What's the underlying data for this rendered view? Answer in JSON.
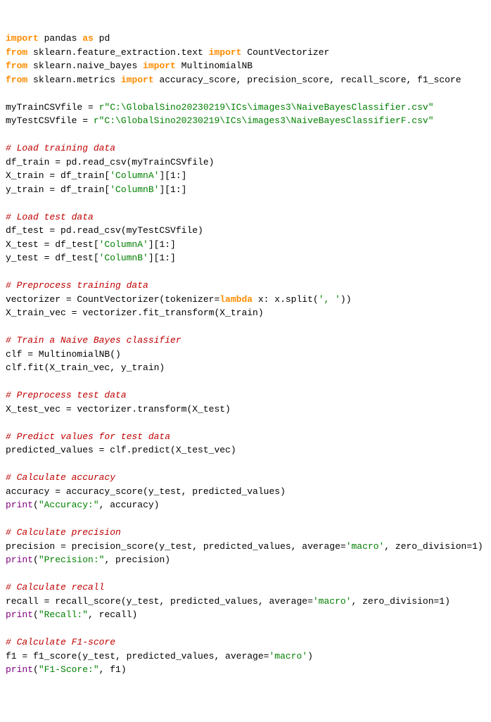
{
  "code": {
    "l1_kw1": "import",
    "l1_nm1": " pandas ",
    "l1_kw2": "as",
    "l1_nm2": " pd",
    "l2_kw1": "from",
    "l2_nm1": " sklearn.feature_extraction.text ",
    "l2_kw2": "import",
    "l2_nm2": " CountVectorizer",
    "l3_kw1": "from",
    "l3_nm1": " sklearn.naive_bayes ",
    "l3_kw2": "import",
    "l3_nm2": " MultinomialNB",
    "l4_kw1": "from",
    "l4_nm1": " sklearn.metrics ",
    "l4_kw2": "import",
    "l4_nm2": " accuracy_score, precision_score, recall_score, f1_score",
    "l6_nm1": "myTrainCSVfile = ",
    "l6_str1": "r\"C:\\GlobalSino20230219\\ICs\\images3\\NaiveBayesClassifier.csv\"",
    "l7_nm1": "myTestCSVfile = ",
    "l7_str1": "r\"C:\\GlobalSino20230219\\ICs\\images3\\NaiveBayesClassifierF.csv\"",
    "l9_cmt": "# Load training data",
    "l10_nm": "df_train = pd.read_csv(myTrainCSVfile)",
    "l11_nm1": "X_train = df_train[",
    "l11_str": "'ColumnA'",
    "l11_nm2": "][1:]",
    "l12_nm1": "y_train = df_train[",
    "l12_str": "'ColumnB'",
    "l12_nm2": "][1:]",
    "l14_cmt": "# Load test data",
    "l15_nm": "df_test = pd.read_csv(myTestCSVfile)",
    "l16_nm1": "X_test = df_test[",
    "l16_str": "'ColumnA'",
    "l16_nm2": "][1:]",
    "l17_nm1": "y_test = df_test[",
    "l17_str": "'ColumnB'",
    "l17_nm2": "][1:]",
    "l19_cmt": "# Preprocess training data",
    "l20_nm1": "vectorizer = CountVectorizer(tokenizer=",
    "l20_kw": "lambda",
    "l20_nm2": " x: x.split(",
    "l20_str": "', '",
    "l20_nm3": "))",
    "l21_nm": "X_train_vec = vectorizer.fit_transform(X_train)",
    "l23_cmt": "# Train a Naive Bayes classifier",
    "l24_nm": "clf = MultinomialNB()",
    "l25_nm": "clf.fit(X_train_vec, y_train)",
    "l27_cmt": "# Preprocess test data",
    "l28_nm": "X_test_vec = vectorizer.transform(X_test)",
    "l30_cmt": "# Predict values for test data",
    "l31_nm": "predicted_values = clf.predict(X_test_vec)",
    "l33_cmt": "# Calculate accuracy",
    "l34_nm": "accuracy = accuracy_score(y_test, predicted_values)",
    "l35_fn": "print",
    "l35_nm1": "(",
    "l35_str": "\"Accuracy:\"",
    "l35_nm2": ", accuracy)",
    "l37_cmt": "# Calculate precision",
    "l38_nm1": "precision = precision_score(y_test, predicted_values, average=",
    "l38_str": "'macro'",
    "l38_nm2": ", zero_division=1)",
    "l39_fn": "print",
    "l39_nm1": "(",
    "l39_str": "\"Precision:\"",
    "l39_nm2": ", precision)",
    "l41_cmt": "# Calculate recall",
    "l42_nm1": "recall = recall_score(y_test, predicted_values, average=",
    "l42_str": "'macro'",
    "l42_nm2": ", zero_division=1)",
    "l43_fn": "print",
    "l43_nm1": "(",
    "l43_str": "\"Recall:\"",
    "l43_nm2": ", recall)",
    "l45_cmt": "# Calculate F1-score",
    "l46_nm1": "f1 = f1_score(y_test, predicted_values, average=",
    "l46_str": "'macro'",
    "l46_nm2": ")",
    "l47_fn": "print",
    "l47_nm1": "(",
    "l47_str": "\"F1-Score:\"",
    "l47_nm2": ", f1)"
  }
}
